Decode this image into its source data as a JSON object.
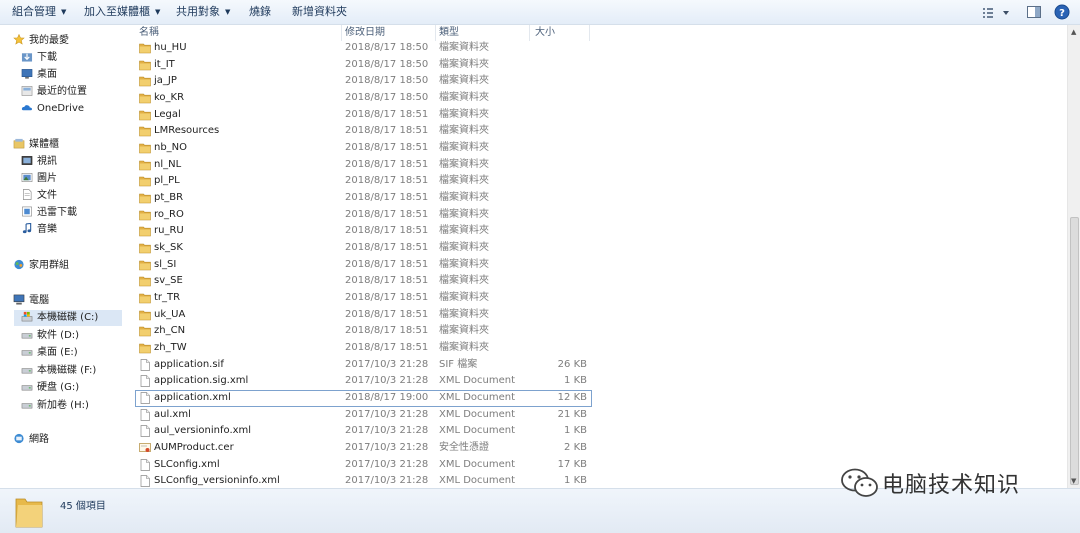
{
  "toolbar": {
    "organize": "組合管理",
    "add_to_library": "加入至媒體櫃",
    "share_with": "共用對象",
    "burn": "燒錄",
    "new_folder": "新增資料夾"
  },
  "nav": {
    "favorites": "我的最愛",
    "downloads": "下載",
    "desktop": "桌面",
    "recent": "最近的位置",
    "onedrive": "OneDrive",
    "libraries": "媒體櫃",
    "videos": "視訊",
    "pictures": "圖片",
    "documents": "文件",
    "xunlei": "迅雷下載",
    "music": "音樂",
    "homegroup": "家用群組",
    "computer": "電腦",
    "drive_c": "本機磁碟 (C:)",
    "drive_d": "軟件 (D:)",
    "drive_e": "桌面 (E:)",
    "drive_f": "本機磁碟 (F:)",
    "drive_g": "硬盘 (G:)",
    "drive_h": "新加卷 (H:)",
    "network": "網路"
  },
  "columns": {
    "name": "名稱",
    "date": "修改日期",
    "type": "類型",
    "size": "大小"
  },
  "files": [
    {
      "name": "hu_HU",
      "date": "2018/8/17 18:50",
      "type": "檔案資料夾",
      "size": "",
      "kind": "folder"
    },
    {
      "name": "it_IT",
      "date": "2018/8/17 18:50",
      "type": "檔案資料夾",
      "size": "",
      "kind": "folder"
    },
    {
      "name": "ja_JP",
      "date": "2018/8/17 18:50",
      "type": "檔案資料夾",
      "size": "",
      "kind": "folder"
    },
    {
      "name": "ko_KR",
      "date": "2018/8/17 18:50",
      "type": "檔案資料夾",
      "size": "",
      "kind": "folder"
    },
    {
      "name": "Legal",
      "date": "2018/8/17 18:51",
      "type": "檔案資料夾",
      "size": "",
      "kind": "folder"
    },
    {
      "name": "LMResources",
      "date": "2018/8/17 18:51",
      "type": "檔案資料夾",
      "size": "",
      "kind": "folder"
    },
    {
      "name": "nb_NO",
      "date": "2018/8/17 18:51",
      "type": "檔案資料夾",
      "size": "",
      "kind": "folder"
    },
    {
      "name": "nl_NL",
      "date": "2018/8/17 18:51",
      "type": "檔案資料夾",
      "size": "",
      "kind": "folder"
    },
    {
      "name": "pl_PL",
      "date": "2018/8/17 18:51",
      "type": "檔案資料夾",
      "size": "",
      "kind": "folder"
    },
    {
      "name": "pt_BR",
      "date": "2018/8/17 18:51",
      "type": "檔案資料夾",
      "size": "",
      "kind": "folder"
    },
    {
      "name": "ro_RO",
      "date": "2018/8/17 18:51",
      "type": "檔案資料夾",
      "size": "",
      "kind": "folder"
    },
    {
      "name": "ru_RU",
      "date": "2018/8/17 18:51",
      "type": "檔案資料夾",
      "size": "",
      "kind": "folder"
    },
    {
      "name": "sk_SK",
      "date": "2018/8/17 18:51",
      "type": "檔案資料夾",
      "size": "",
      "kind": "folder"
    },
    {
      "name": "sl_SI",
      "date": "2018/8/17 18:51",
      "type": "檔案資料夾",
      "size": "",
      "kind": "folder"
    },
    {
      "name": "sv_SE",
      "date": "2018/8/17 18:51",
      "type": "檔案資料夾",
      "size": "",
      "kind": "folder"
    },
    {
      "name": "tr_TR",
      "date": "2018/8/17 18:51",
      "type": "檔案資料夾",
      "size": "",
      "kind": "folder"
    },
    {
      "name": "uk_UA",
      "date": "2018/8/17 18:51",
      "type": "檔案資料夾",
      "size": "",
      "kind": "folder"
    },
    {
      "name": "zh_CN",
      "date": "2018/8/17 18:51",
      "type": "檔案資料夾",
      "size": "",
      "kind": "folder"
    },
    {
      "name": "zh_TW",
      "date": "2018/8/17 18:51",
      "type": "檔案資料夾",
      "size": "",
      "kind": "folder"
    },
    {
      "name": "application.sif",
      "date": "2017/10/3 21:28",
      "type": "SIF 檔案",
      "size": "26 KB",
      "kind": "file"
    },
    {
      "name": "application.sig.xml",
      "date": "2017/10/3 21:28",
      "type": "XML Document",
      "size": "1 KB",
      "kind": "file"
    },
    {
      "name": "application.xml",
      "date": "2018/8/17 19:00",
      "type": "XML Document",
      "size": "12 KB",
      "kind": "file",
      "selected": true
    },
    {
      "name": "aul.xml",
      "date": "2017/10/3 21:28",
      "type": "XML Document",
      "size": "21 KB",
      "kind": "file"
    },
    {
      "name": "aul_versioninfo.xml",
      "date": "2017/10/3 21:28",
      "type": "XML Document",
      "size": "1 KB",
      "kind": "file"
    },
    {
      "name": "AUMProduct.cer",
      "date": "2017/10/3 21:28",
      "type": "安全性憑證",
      "size": "2 KB",
      "kind": "cert"
    },
    {
      "name": "SLConfig.xml",
      "date": "2017/10/3 21:28",
      "type": "XML Document",
      "size": "17 KB",
      "kind": "file"
    },
    {
      "name": "SLConfig_versioninfo.xml",
      "date": "2017/10/3 21:28",
      "type": "XML Document",
      "size": "1 KB",
      "kind": "file"
    }
  ],
  "status": {
    "item_count": "45 個項目"
  },
  "watermark": {
    "text": "电脑技术知识"
  }
}
